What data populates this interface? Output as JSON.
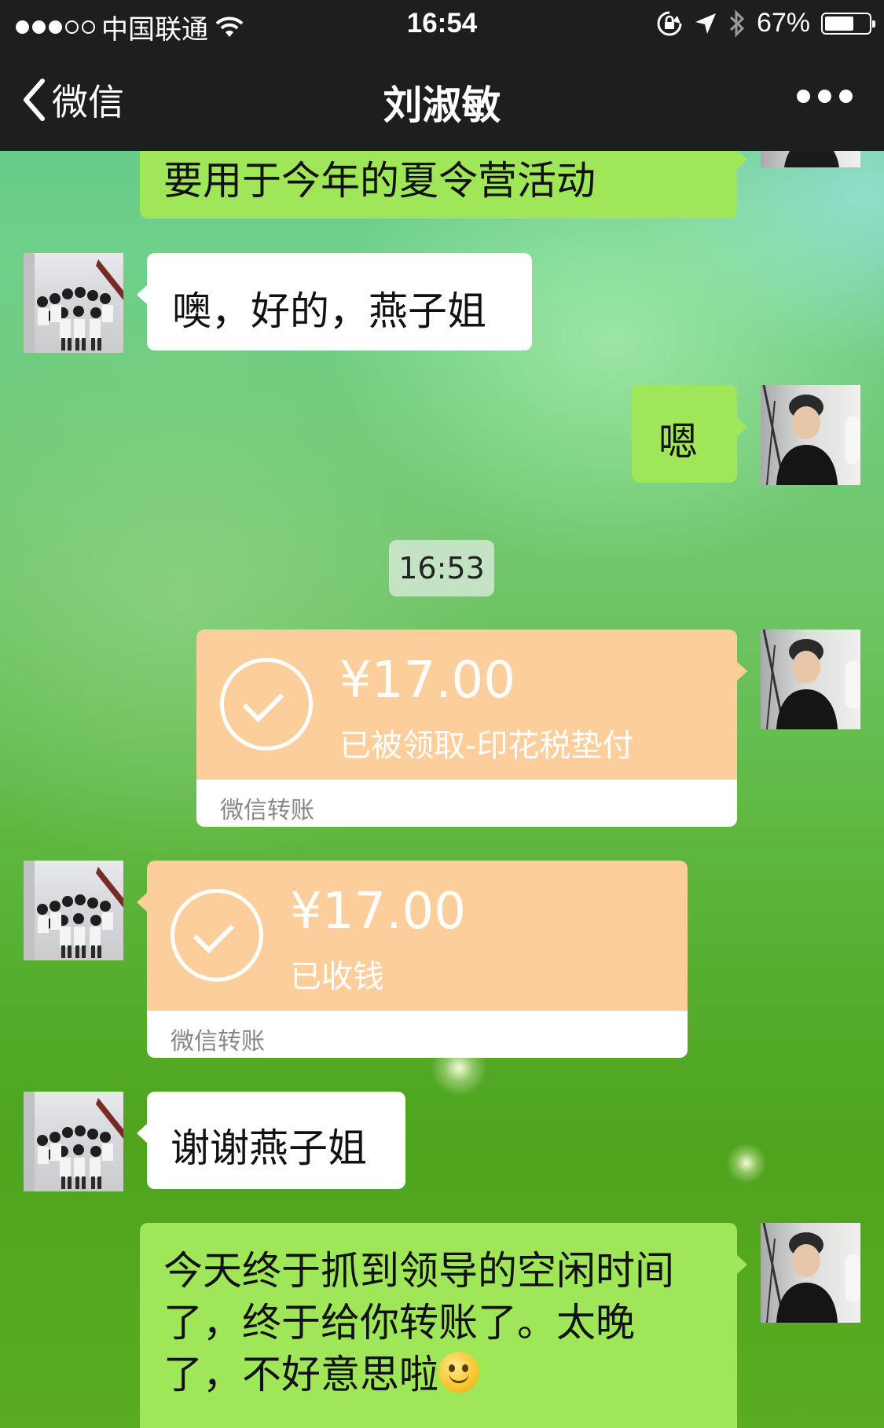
{
  "status_bar": {
    "carrier": "中国联通",
    "time": "16:54",
    "battery": "67%",
    "battery_level": 0.67
  },
  "nav": {
    "back_label": "微信",
    "title": "刘淑敏"
  },
  "messages": [
    {
      "id": "m0",
      "side": "right",
      "text": "要用于今年的夏令营活动"
    },
    {
      "id": "m1",
      "side": "left",
      "text": "噢，好的，燕子姐"
    },
    {
      "id": "m2",
      "side": "right",
      "text": "嗯"
    },
    {
      "id": "m5",
      "side": "left",
      "text": "谢谢燕子姐"
    },
    {
      "id": "m6",
      "side": "right",
      "lines": [
        "今天终于抓到领导的空闲时间",
        "了，终于给你转账了。太晚",
        "了，不好意思啦"
      ],
      "emoji": "smile-emoji"
    }
  ],
  "timestamp": "16:53",
  "transfers": [
    {
      "id": "t1",
      "side": "right",
      "amount": "¥17.00",
      "status": "已被领取-印花税垫付",
      "footer": "微信转账"
    },
    {
      "id": "t2",
      "side": "left",
      "amount": "¥17.00",
      "status": "已收钱",
      "footer": "微信转账"
    }
  ],
  "colors": {
    "nav_bg": "#1d1e1f",
    "bubble_green": "#9fe658",
    "bubble_white": "#ffffff",
    "transfer_orange": "#fcce9b"
  }
}
